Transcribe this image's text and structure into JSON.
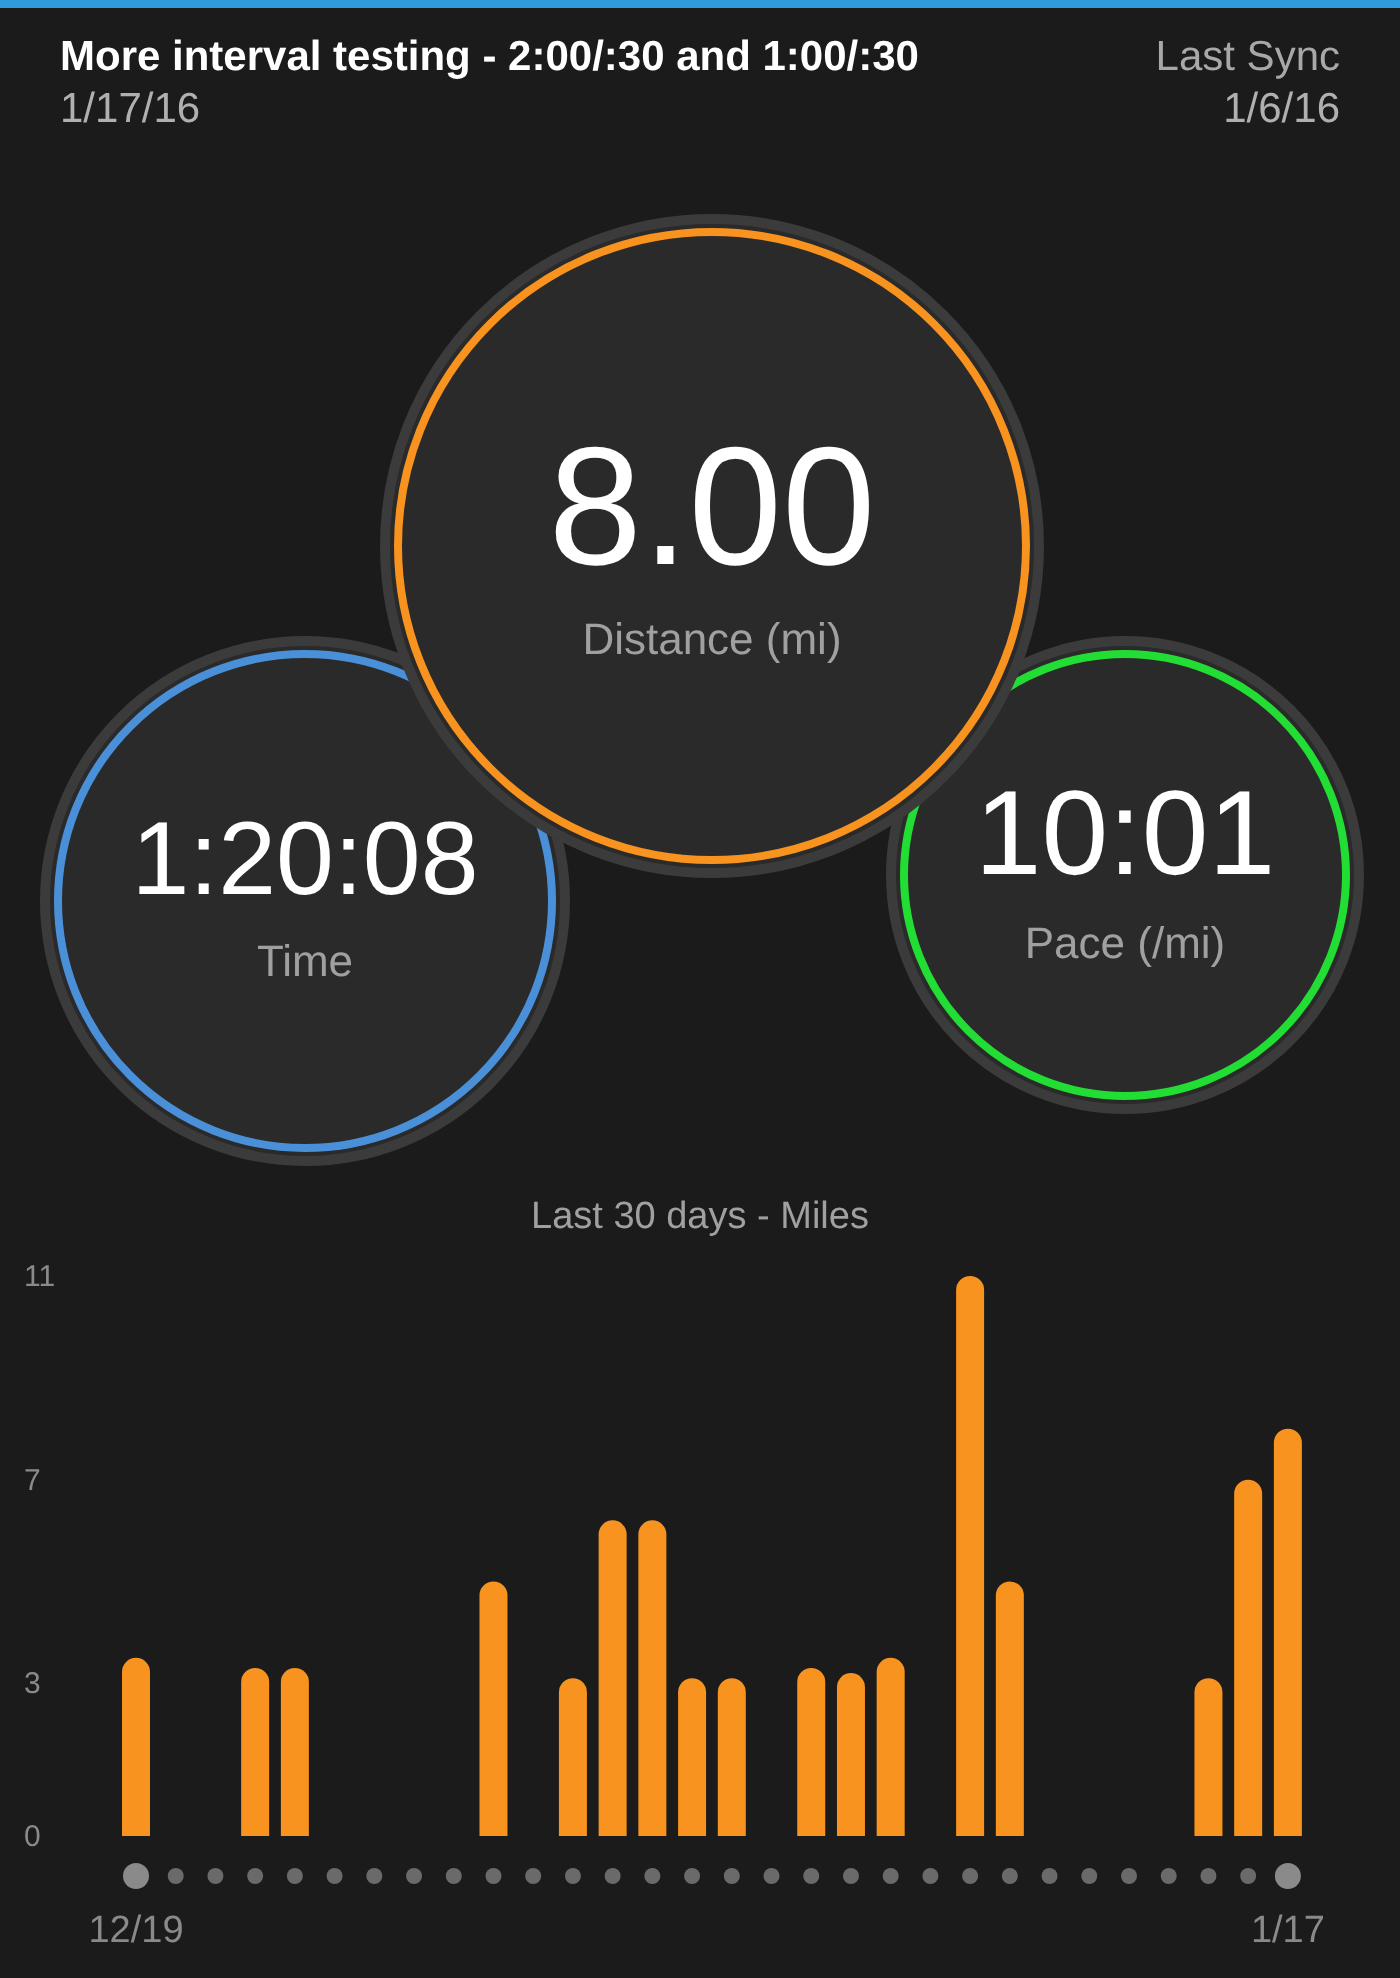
{
  "header": {
    "title": "More interval testing - 2:00/:30 and 1:00/:30",
    "date": "1/17/16",
    "sync_label": "Last Sync",
    "sync_date": "1/6/16"
  },
  "metrics": [
    {
      "kind": "distance",
      "value": "8.00",
      "label": "Distance (mi)",
      "color": "#f7931e"
    },
    {
      "kind": "time",
      "value": "1:20:08",
      "label": "Time",
      "color": "#4a90d9"
    },
    {
      "kind": "pace",
      "value": "10:01",
      "label": "Pace (/mi)",
      "color": "#22dd33"
    }
  ],
  "chart": {
    "title": "Last 30 days - Miles",
    "chart_data": {
      "type": "bar",
      "categories": [
        "12/19",
        null,
        null,
        null,
        null,
        null,
        null,
        null,
        null,
        null,
        null,
        null,
        null,
        null,
        null,
        null,
        null,
        null,
        null,
        null,
        null,
        null,
        null,
        null,
        null,
        null,
        null,
        null,
        null,
        "1/17"
      ],
      "series": [
        {
          "color": "#f7931e",
          "values": [
            3.5,
            0,
            0,
            3.3,
            3.3,
            0,
            0,
            0,
            0,
            5.0,
            0,
            3.1,
            6.2,
            6.2,
            3.1,
            3.1,
            0,
            3.3,
            3.2,
            3.5,
            0,
            11.0,
            5.0,
            0,
            0,
            0,
            0,
            3.1,
            7.0,
            8.0
          ]
        }
      ],
      "ylim": [
        0,
        11
      ],
      "yticks": [
        0,
        3,
        7,
        11
      ]
    }
  }
}
